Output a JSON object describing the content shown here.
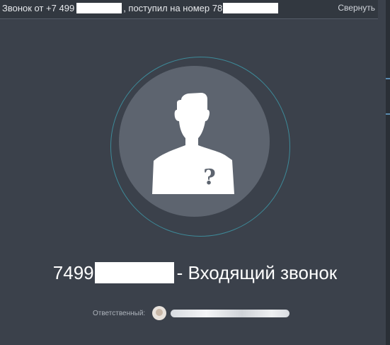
{
  "header": {
    "call_prefix": "Звонок от +7 499",
    "call_middle": ", поступил на номер 78",
    "collapse_label": "Свернуть"
  },
  "caller": {
    "number_prefix": "7499",
    "status_text": "- Входящий звонок"
  },
  "responsible": {
    "label": "Ответственный:"
  },
  "icons": {
    "avatar": "unknown-person-icon",
    "user_avatar": "user-avatar"
  },
  "colors": {
    "background": "#3b414b",
    "top_bar": "#323840",
    "ring": "#3d8a99",
    "avatar_circle": "#5d646f",
    "text": "#ffffff"
  }
}
